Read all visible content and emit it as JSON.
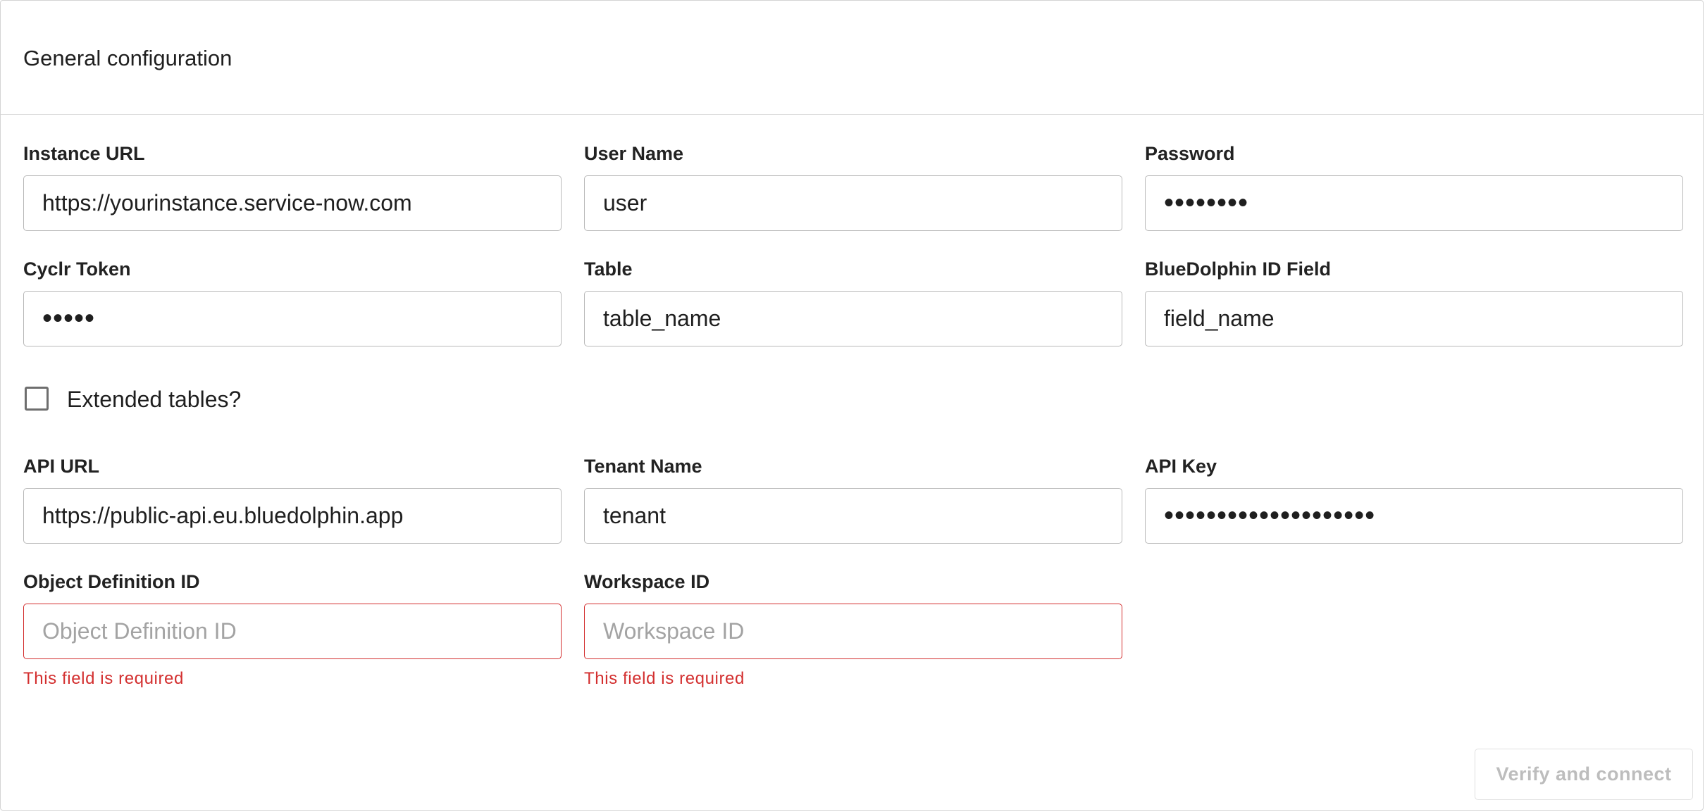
{
  "panel": {
    "title": "General configuration"
  },
  "fields": {
    "instance_url": {
      "label": "Instance URL",
      "value": "https://yourinstance.service-now.com"
    },
    "user_name": {
      "label": "User Name",
      "value": "user"
    },
    "password": {
      "label": "Password",
      "value": "••••••••"
    },
    "cyclr_token": {
      "label": "Cyclr Token",
      "value": "•••••"
    },
    "table": {
      "label": "Table",
      "value": "table_name"
    },
    "bluedolphin_id_field": {
      "label": "BlueDolphin ID Field",
      "value": "field_name"
    },
    "api_url": {
      "label": "API URL",
      "value": "https://public-api.eu.bluedolphin.app"
    },
    "tenant_name": {
      "label": "Tenant Name",
      "value": "tenant"
    },
    "api_key": {
      "label": "API Key",
      "value": "••••••••••••••••••••"
    },
    "object_definition_id": {
      "label": "Object Definition ID",
      "value": "",
      "placeholder": "Object Definition ID",
      "error": "This field is required"
    },
    "workspace_id": {
      "label": "Workspace ID",
      "value": "",
      "placeholder": "Workspace ID",
      "error": "This field is required"
    }
  },
  "extended_tables": {
    "label": "Extended tables?",
    "checked": false
  },
  "actions": {
    "verify_label": "Verify and connect",
    "verify_disabled": true
  },
  "colors": {
    "error": "#d32f2f",
    "border": "#b9b9b9",
    "disabled_text": "#bdbdbd"
  }
}
